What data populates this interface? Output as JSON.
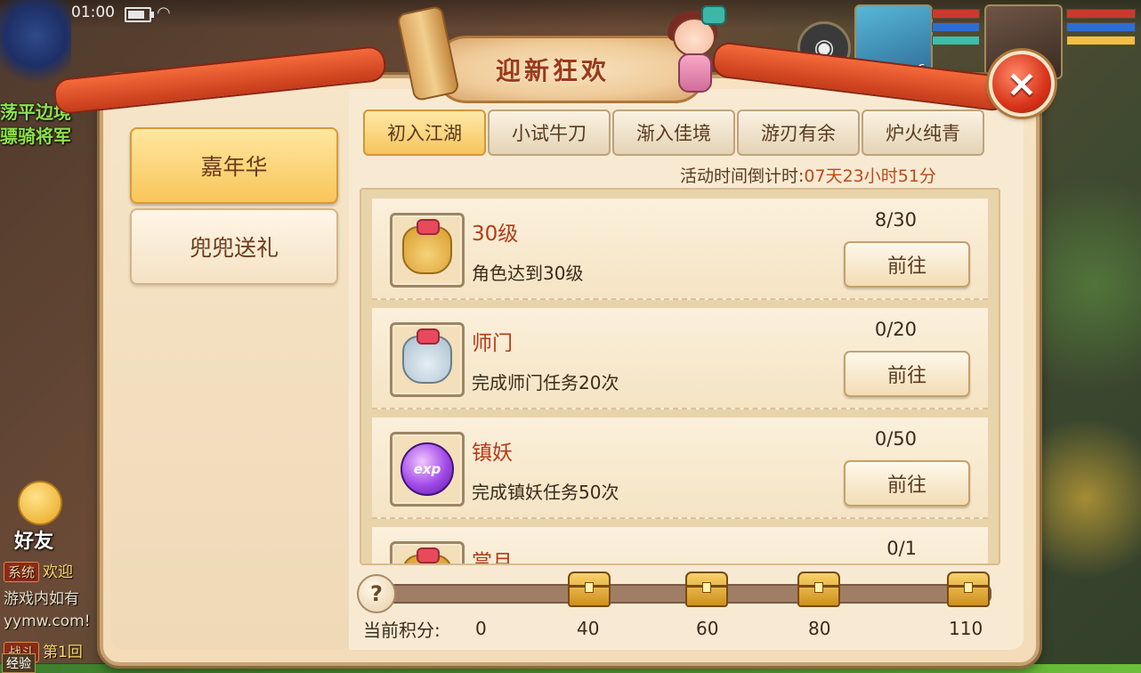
{
  "status_bar": {
    "time": "01:00"
  },
  "game_bg": {
    "npc_lines": [
      "荡平边境",
      "骠骑将军"
    ],
    "portrait1_level": "6",
    "friend_label": "好友",
    "chat": [
      {
        "tag": "系统",
        "text": "欢迎"
      },
      {
        "tag": "",
        "text": "游戏内如有"
      },
      {
        "tag": "",
        "text": "yymw.com!"
      },
      {
        "tag": "战斗",
        "text": "第1回"
      }
    ],
    "exp_label": "经验"
  },
  "dialog": {
    "title": "迎新狂欢",
    "close_label": "×",
    "side_tabs": [
      {
        "label": "嘉年华",
        "active": true
      },
      {
        "label": "兜兜送礼",
        "active": false
      }
    ],
    "stage_tabs": [
      {
        "label": "初入江湖",
        "active": true
      },
      {
        "label": "小试牛刀",
        "active": false
      },
      {
        "label": "渐入佳境",
        "active": false
      },
      {
        "label": "游刃有余",
        "active": false
      },
      {
        "label": "炉火纯青",
        "active": false
      }
    ],
    "countdown_label": "活动时间倒计时:",
    "countdown_value": "07天23小时51分",
    "tasks": [
      {
        "name": "30级",
        "desc": "角色达到30级",
        "progress": "8/30",
        "button": "前往",
        "icon": "gold-bag-icon"
      },
      {
        "name": "师门",
        "desc": "完成师门任务20次",
        "progress": "0/20",
        "button": "前往",
        "icon": "silver-bag-icon"
      },
      {
        "name": "镇妖",
        "desc": "完成镇妖任务50次",
        "progress": "0/50",
        "button": "前往",
        "icon": "exp-orb-icon"
      },
      {
        "name": "赏月",
        "desc": "",
        "progress": "0/1",
        "button": "",
        "icon": "gold-bag-icon"
      }
    ],
    "exp_orb_text": "exp",
    "points": {
      "label": "当前积分:",
      "current": "0",
      "milestones": [
        "40",
        "60",
        "80",
        "110"
      ]
    },
    "help_label": "?"
  }
}
